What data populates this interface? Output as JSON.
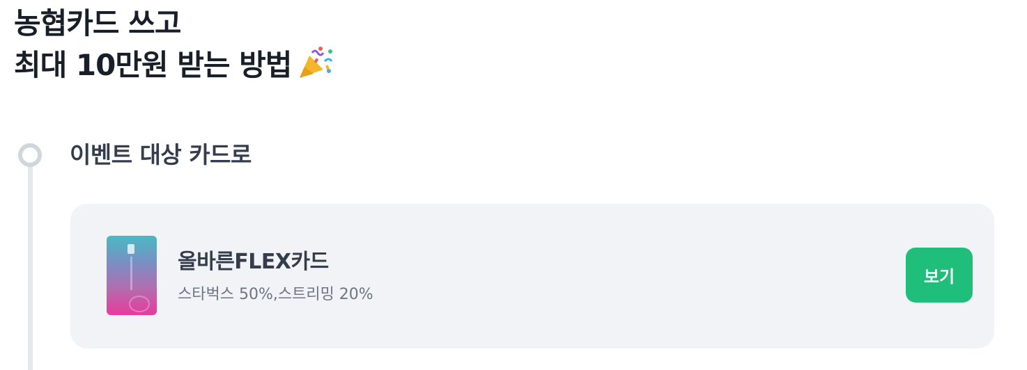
{
  "header": {
    "title_line1": "농협카드 쓰고",
    "title_line2": "최대 10만원 받는 방법",
    "title_icon": "party-popper-icon"
  },
  "step": {
    "label": "이벤트 대상 카드로"
  },
  "card": {
    "name": "올바른FLEX카드",
    "benefit": "스타벅스 50%,스트리밍 20%",
    "button_label": "보기"
  },
  "colors": {
    "accent_green": "#1fbe7a",
    "card_bg": "#f2f3f6",
    "timeline": "#d1d6db"
  }
}
